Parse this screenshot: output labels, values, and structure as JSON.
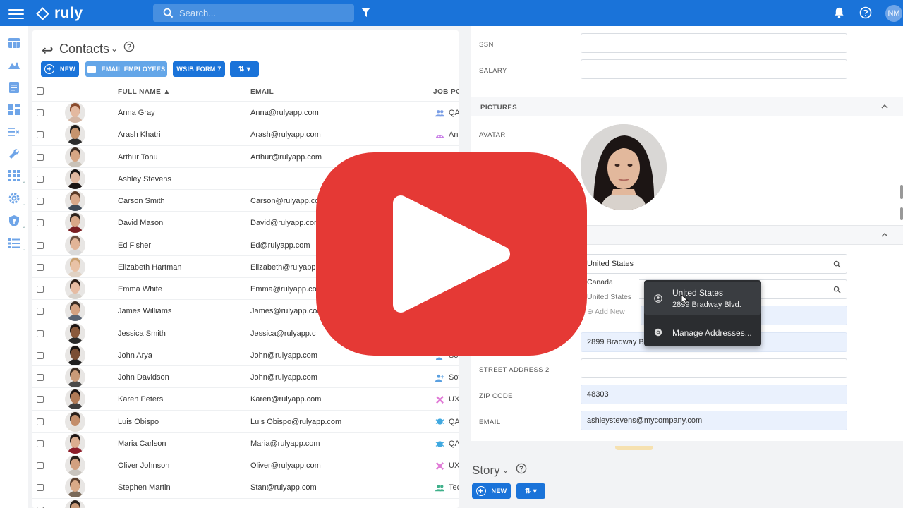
{
  "app": {
    "brand": "ruly",
    "search_placeholder": "Search...",
    "user_initials": "NM",
    "brand_color": "#1a73d9"
  },
  "contacts": {
    "title": "Contacts",
    "buttons": {
      "new": "NEW",
      "email_employees": "EMAIL EMPLOYEES",
      "wsib": "WSIB FORM 7"
    },
    "columns": {
      "full_name": "FULL NAME",
      "email": "EMAIL",
      "job": "JOB PO"
    },
    "rows": [
      {
        "name": "Anna Gray",
        "email": "Anna@rulyapp.com",
        "job": "QA",
        "job_icon": "people-icon",
        "skin": "#e3b9a0",
        "hair": "#8a4c2e",
        "shirt": "#d4b6a4"
      },
      {
        "name": "Arash Khatri",
        "email": "Arash@rulyapp.com",
        "job": "An",
        "job_icon": "android-icon",
        "skin": "#c6946e",
        "hair": "#1e1a18",
        "shirt": "#2b2b2b"
      },
      {
        "name": "Arthur Tonu",
        "email": "Arthur@rulyapp.com",
        "job": "",
        "job_icon": "",
        "skin": "#d6a684",
        "hair": "#3a2a20",
        "shirt": "#c9c2b8"
      },
      {
        "name": "Ashley Stevens",
        "email": "",
        "job": "",
        "job_icon": "",
        "skin": "#e0b8a0",
        "hair": "#1a1514",
        "shirt": "#1a1514"
      },
      {
        "name": "Carson Smith",
        "email": "Carson@rulyapp.com",
        "job": "",
        "job_icon": "",
        "skin": "#d9a98a",
        "hair": "#5a3a26",
        "shirt": "#3f4a57"
      },
      {
        "name": "David Mason",
        "email": "David@rulyapp.com",
        "job": "",
        "job_icon": "",
        "skin": "#d8a888",
        "hair": "#2d241e",
        "shirt": "#7a1e22"
      },
      {
        "name": "Ed Fisher",
        "email": "Ed@rulyapp.com",
        "job": "",
        "job_icon": "",
        "skin": "#e1b497",
        "hair": "#6d5140",
        "shirt": "#d9d9d9"
      },
      {
        "name": "Elizabeth Hartman",
        "email": "Elizabeth@rulyapp.",
        "job": "",
        "job_icon": "",
        "skin": "#e9c2a6",
        "hair": "#c9a070",
        "shirt": "#e0d2c4"
      },
      {
        "name": "Emma White",
        "email": "Emma@rulyapp.com",
        "job": "",
        "job_icon": "",
        "skin": "#e6bca3",
        "hair": "#2a1c16",
        "shirt": "#d6d2cc"
      },
      {
        "name": "James Williams",
        "email": "James@rulyapp.com",
        "job": "",
        "job_icon": "",
        "skin": "#d5a382",
        "hair": "#3a2d24",
        "shirt": "#5a6473"
      },
      {
        "name": "Jessica Smith",
        "email": "Jessica@rulyapp.c",
        "job": "",
        "job_icon": "",
        "skin": "#8a5a3c",
        "hair": "#1b1412",
        "shirt": "#2a2a2a"
      },
      {
        "name": "John Arya",
        "email": "John@rulyapp.com",
        "job": "So",
        "job_icon": "person-icon",
        "skin": "#7a4e34",
        "hair": "#1a1412",
        "shirt": "#1f1f1f"
      },
      {
        "name": "John Davidson",
        "email": "John@rulyapp.com",
        "job": "Sof",
        "job_icon": "person-plus-icon",
        "skin": "#c99a78",
        "hair": "#3a2c22",
        "shirt": "#4a4a4a"
      },
      {
        "name": "Karen Peters",
        "email": "Karen@rulyapp.com",
        "job": "UX /",
        "job_icon": "design-icon",
        "skin": "#b07a56",
        "hair": "#1c1412",
        "shirt": "#3d3d3d"
      },
      {
        "name": "Luis Obispo",
        "email": "Luis Obispo@rulyapp.com",
        "job": "QA",
        "job_icon": "bug-icon",
        "skin": "#c48e6a",
        "hair": "#2a201a",
        "shirt": "#e6e2dc"
      },
      {
        "name": "Maria Carlson",
        "email": "Maria@rulyapp.com",
        "job": "QA",
        "job_icon": "bug-icon",
        "skin": "#dcae90",
        "hair": "#1e1614",
        "shirt": "#8e1e2a"
      },
      {
        "name": "Oliver Johnson",
        "email": "Oliver@rulyapp.com",
        "job": "UX /",
        "job_icon": "design-icon",
        "skin": "#d2a080",
        "hair": "#2c221c",
        "shirt": "#c8c4be"
      },
      {
        "name": "Stephen Martin",
        "email": "Stan@rulyapp.com",
        "job": "Tec",
        "job_icon": "team-icon",
        "skin": "#d9aa88",
        "hair": "#5a3f2e",
        "shirt": "#7a6a5a"
      },
      {
        "name": "",
        "email": "",
        "job": "",
        "job_icon": "",
        "skin": "#c99a78",
        "hair": "#2a201a",
        "shirt": "#444"
      }
    ]
  },
  "form": {
    "ssn_label": "SSN",
    "salary_label": "SALARY",
    "pictures_header": "PICTURES",
    "avatar_label": "AVATAR",
    "country_value": "United States",
    "dd_canada": "Canada",
    "dd_us": "United States",
    "dd_add_new": "Add New",
    "address_value": "2899 Bradway B",
    "street2_label": "STREET ADDRESS 2",
    "zip_label": "ZIP CODE",
    "zip_value": "48303",
    "email_label": "EMAIL",
    "email_value": "ashleystevens@mycompany.com"
  },
  "autofill_popup": {
    "item_title": "United States",
    "item_subtitle": "2899 Bradway Blvd.",
    "manage": "Manage Addresses..."
  },
  "story": {
    "title": "Story",
    "new": "NEW"
  }
}
